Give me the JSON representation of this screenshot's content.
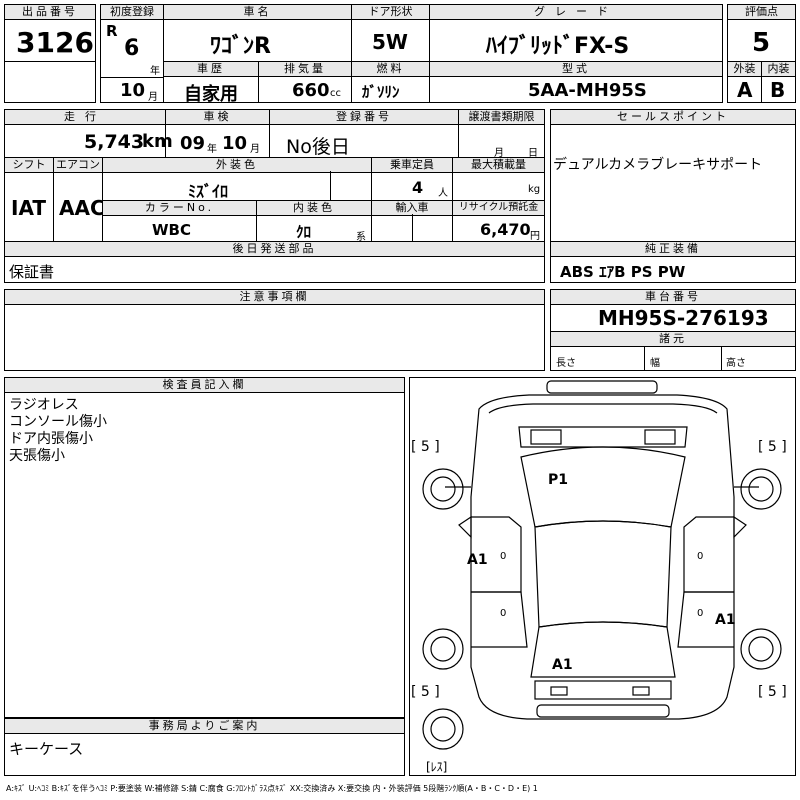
{
  "header": {
    "lot_label": "出品番号",
    "lot_no": "3126",
    "first_reg_label": "初度登録",
    "era": "R",
    "year": "6",
    "year_unit": "年",
    "month": "10",
    "month_unit": "月",
    "car_name_label": "車名",
    "car_name": "ﾜｺﾞﾝR",
    "door_label": "ドア形状",
    "door": "5W",
    "grade_label": "グレード",
    "grade": "ﾊｲﾌﾞﾘｯﾄﾞFX-S",
    "score_label": "評価点",
    "score": "5",
    "history_label": "車歴",
    "history": "自家用",
    "displacement_label": "排気量",
    "displacement": "660",
    "displacement_unit": "cc",
    "fuel_label": "燃料",
    "fuel": "ｶﾞｿﾘﾝ",
    "model_label": "型式",
    "model": "5AA-MH95S",
    "ext_label": "外装",
    "ext": "A",
    "int_label": "内装",
    "int": "B"
  },
  "row2": {
    "mileage_label": "走行",
    "mileage": "5,743",
    "mileage_unit": "km",
    "inspect_label": "車検",
    "inspect_year": "09",
    "inspect_year_unit": "年",
    "inspect_month": "10",
    "inspect_month_unit": "月",
    "reg_label": "登録番号",
    "reg": "No後日",
    "transfer_label": "譲渡書類期限",
    "transfer_month": "月",
    "transfer_day": "日",
    "sales_label": "セールスポイント",
    "sales": "デュアルカメラブレーキサポート"
  },
  "row3": {
    "shift_label": "シフト",
    "shift": "IAT",
    "ac_label": "エアコン",
    "ac": "AAC",
    "color_label": "外装色",
    "color": "ﾐｽﾞｲﾛ",
    "seats_label": "乗車定員",
    "seats": "4",
    "seats_unit": "人",
    "load_label": "最大積載量",
    "load_unit": "kg",
    "colorno_label": "カラーNo.",
    "colorno": "WBC",
    "intcolor_label": "内装色",
    "intcolor": "ｸﾛ",
    "intcolor_unit": "系",
    "import_label": "輸入車",
    "recycle_label": "リサイクル預託金",
    "recycle": "6,470",
    "recycle_unit": "円"
  },
  "parts": {
    "label": "後日発送部品",
    "value": "保証書"
  },
  "equip": {
    "label": "純正装備",
    "value": "ABS ｴｱB PS PW"
  },
  "notes": {
    "label": "注意事項欄"
  },
  "chassis": {
    "label": "車台番号",
    "value": "MH95S-276193",
    "spec_label": "諸元",
    "len": "長さ",
    "wid": "幅",
    "hgt": "高さ"
  },
  "inspector": {
    "label": "検査員記入欄",
    "lines": [
      "ラジオレス",
      "コンソール傷小",
      "ドア内張傷小",
      "天張傷小"
    ]
  },
  "office": {
    "label": "事務局よりご案内",
    "value": "キーケース"
  },
  "diagram": {
    "tire_fl": "[ 5 ]",
    "tire_fr": "[ 5 ]",
    "tire_rl": "[ 5 ]",
    "tire_rr": "[ 5 ]",
    "mark_p1": "P1",
    "mark_a1_left": "A1",
    "mark_a1_right": "A1",
    "mark_a1_rear": "A1",
    "zero1": "0",
    "zero2": "0",
    "zero3": "0",
    "zero4": "0",
    "spare": "[ﾚｽ]"
  },
  "legend": "A:ｷｽﾞ U:ﾍｺﾐ B:ｷｽﾞを伴うﾍｺﾐ P:要塗装 W:補修跡 S:錆 C:腐食 G:ﾌﾛﾝﾄｶﾞﾗｽ点ｷｽﾞ XX:交換済み X:要交換 内・外装評価 5段階ﾗﾝｸ順(A・B・C・D・E) 1"
}
